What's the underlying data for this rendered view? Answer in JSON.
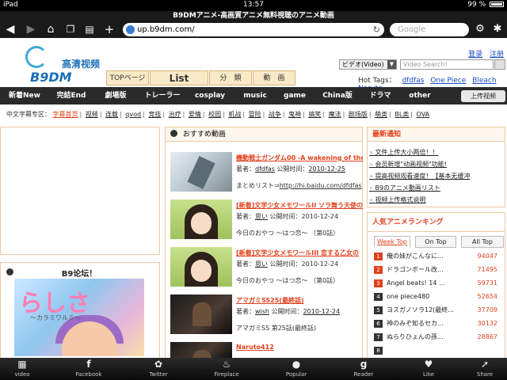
{
  "status": {
    "device": "iPad",
    "time": "13:57",
    "battery": "99 %"
  },
  "page_title": "B9DMアニメ-高画質アニメ無料視聴のアニメ動画",
  "browser": {
    "url": "up.b9dm.com/",
    "search_placeholder": "Google"
  },
  "logo": {
    "cn": "高清视频",
    "en": "B9DM"
  },
  "head_tabs": [
    "TOPページ",
    "List",
    "分　類",
    "動　画"
  ],
  "top_links": [
    "登录",
    "注册"
  ],
  "search": {
    "select": "ビデオ(Video)",
    "placeholder": "Video Search!"
  },
  "hot_tags": {
    "label": "Hot Tags：",
    "tags": [
      "dfdfas",
      "One Piece",
      "Bleach",
      "Naruto"
    ]
  },
  "categories": [
    "新着New",
    "完結End",
    "劇場版",
    "トレーラー",
    "cosplay",
    "music",
    "game",
    "China版",
    "ドラマ",
    "other"
  ],
  "upload_label": "上传视频",
  "subcats": {
    "label": "中文字幕专区：",
    "items": [
      "字幕首页",
      "视频",
      "连载",
      "qvod",
      "竞技",
      "治疗",
      "爱情",
      "校园",
      "机战",
      "冒险",
      "战争",
      "鬼神",
      "搞笑",
      "魔法",
      "剧场版",
      "萌类",
      "BL类",
      "OVA"
    ]
  },
  "forum_title": "B9论坛！",
  "forum_image": {
    "title": "らしさ",
    "subtitle": "～カラミワルミ～"
  },
  "recommend": {
    "title": "おすすめ動画",
    "items": [
      {
        "title": "機動戦士ガンダム00 -A wakening of the",
        "author_label": "著者：",
        "author": "dfdfas",
        "time_label": "公開时间：",
        "time": "2010-12-25",
        "desc_prefix": "まとめリスト⇒",
        "desc": "http://hi.baidu.com/dfdfas"
      },
      {
        "title": "[新着]文学少女メモワールII ソラ舞う天使の",
        "author_label": "著者：",
        "author": "思い",
        "time_label": "公開时间：",
        "time": "2010-12-24",
        "desc_prefix": "",
        "desc": "今日のおやつ ～はつ恋～ （第0話）"
      },
      {
        "title": "[新着]文学少女メモワールIII 恋する乙女の",
        "author_label": "著者：",
        "author": "思い",
        "time_label": "公開时间：",
        "time": "2010-12-24",
        "desc_prefix": "",
        "desc": "今日のおやつ ～はつ恋～ （第0話）"
      },
      {
        "title": "アマガミSS25(最終話)",
        "author_label": "著者：",
        "author": "wish",
        "time_label": "公開时间：",
        "time": "2010-12-24",
        "desc_prefix": "",
        "desc": "アマガミSS 第25話(最終話)"
      },
      {
        "title": "Naruto412",
        "author_label": "",
        "author": "",
        "time_label": "",
        "time": "",
        "desc_prefix": "",
        "desc": ""
      }
    ]
  },
  "news": {
    "title": "最新通知",
    "items": [
      "文件上传大小两倍！！",
      "会员新增\"动画视频\"功能!",
      "提高视频观看速度！【基本无缓冲",
      "B9のアニメ動画リスト",
      "视频上传格式说明"
    ]
  },
  "ranking": {
    "title": "人気アニメランキング",
    "tabs": [
      "Week Top",
      "On Top",
      "All Top"
    ],
    "items": [
      {
        "rank": "1",
        "title": "俺の妹がこんなに...",
        "views": "94047"
      },
      {
        "rank": "2",
        "title": "ドラゴンボール改...",
        "views": "71495"
      },
      {
        "rank": "3",
        "title": "Angel beats! 14 ...",
        "views": "59731"
      },
      {
        "rank": "4",
        "title": "one piece480",
        "views": "52654"
      },
      {
        "rank": "5",
        "title": "ヨスガノソラ12(最終...",
        "views": "37709"
      },
      {
        "rank": "6",
        "title": "神のみぞ知るセカ...",
        "views": "30132"
      },
      {
        "rank": "7",
        "title": "ぬらりひょんの孫...",
        "views": "28867"
      },
      {
        "rank": "8",
        "title": "",
        "views": ""
      }
    ]
  },
  "bottom_tabs": [
    "video",
    "Facebook",
    "Twitter",
    "Fireplace",
    "Popular",
    "Reader",
    "Like",
    "Share"
  ],
  "colors": {
    "accent_red": "#e0411b",
    "link_blue": "#1a4fc5",
    "panel_border": "#f0c8a0",
    "nav_dark": "#2a2a2a"
  }
}
